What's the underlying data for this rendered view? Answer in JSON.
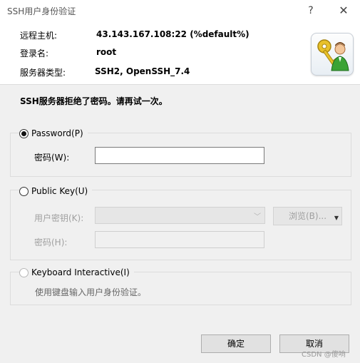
{
  "window": {
    "title": "SSH用户身份验证",
    "help_glyph": "?",
    "close_glyph": "✕"
  },
  "info": {
    "remote_host_label": "远程主机:",
    "remote_host_value": "43.143.167.108:22 (%default%)",
    "login_name_label": "登录名:",
    "login_name_value": "root",
    "server_type_label": "服务器类型:",
    "server_type_value": "SSH2, OpenSSH_7.4",
    "icon": "key-user-icon"
  },
  "message": "SSH服务器拒绝了密码。请再试一次。",
  "password_section": {
    "option_label": "Password(P)",
    "selected": true,
    "password_label": "密码(W):",
    "password_value": ""
  },
  "publickey_section": {
    "option_label": "Public Key(U)",
    "selected": false,
    "user_key_label": "用户密钥(K):",
    "browse_label": "浏览(B)...",
    "passphrase_label": "密码(H):"
  },
  "keyboard_section": {
    "option_label": "Keyboard Interactive(I)",
    "selected": false,
    "hint": "使用键盘输入用户身份验证。"
  },
  "buttons": {
    "ok": "确定",
    "cancel": "取消"
  },
  "watermark": "CSDN @傻响"
}
